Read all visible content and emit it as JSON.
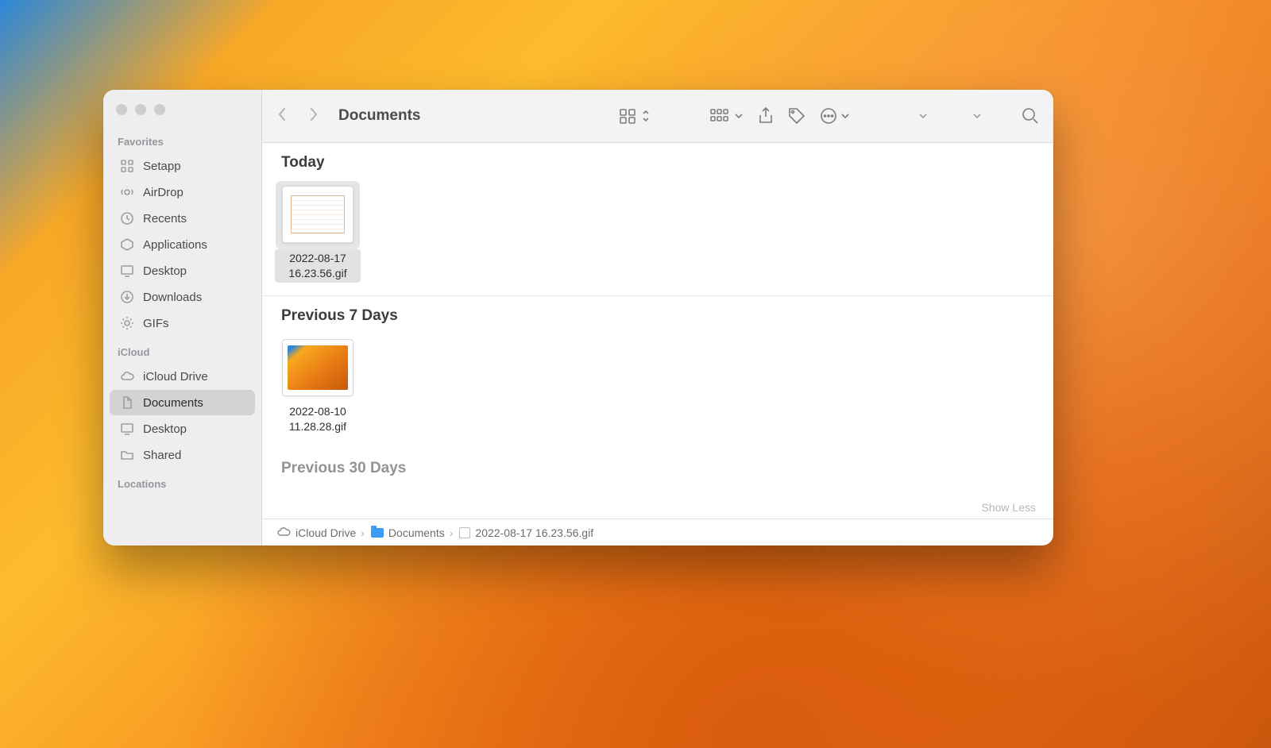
{
  "window": {
    "title": "Documents"
  },
  "sidebar": {
    "sections": [
      {
        "label": "Favorites",
        "items": [
          {
            "label": "Setapp",
            "icon": "setapp"
          },
          {
            "label": "AirDrop",
            "icon": "airdrop"
          },
          {
            "label": "Recents",
            "icon": "clock"
          },
          {
            "label": "Applications",
            "icon": "apps"
          },
          {
            "label": "Desktop",
            "icon": "desktop"
          },
          {
            "label": "Downloads",
            "icon": "downloads"
          },
          {
            "label": "GIFs",
            "icon": "gear"
          }
        ]
      },
      {
        "label": "iCloud",
        "items": [
          {
            "label": "iCloud Drive",
            "icon": "cloud"
          },
          {
            "label": "Documents",
            "icon": "doc",
            "active": true
          },
          {
            "label": "Desktop",
            "icon": "desktop"
          },
          {
            "label": "Shared",
            "icon": "shared"
          }
        ]
      },
      {
        "label": "Locations",
        "items": []
      }
    ]
  },
  "groups": [
    {
      "header": "Today",
      "files": [
        {
          "name": "2022-08-17 16.23.56.gif",
          "thumb": "spreadsheet",
          "selected": true
        }
      ]
    },
    {
      "header": "Previous 7 Days",
      "files": [
        {
          "name": "2022-08-10 11.28.28.gif",
          "thumb": "wallpaper"
        }
      ]
    },
    {
      "header": "Previous 30 Days",
      "files": []
    }
  ],
  "show_less": "Show Less",
  "pathbar": {
    "crumbs": [
      {
        "label": "iCloud Drive",
        "icon": "cloud"
      },
      {
        "label": "Documents",
        "icon": "folder"
      },
      {
        "label": "2022-08-17 16.23.56.gif",
        "icon": "gif"
      }
    ]
  }
}
